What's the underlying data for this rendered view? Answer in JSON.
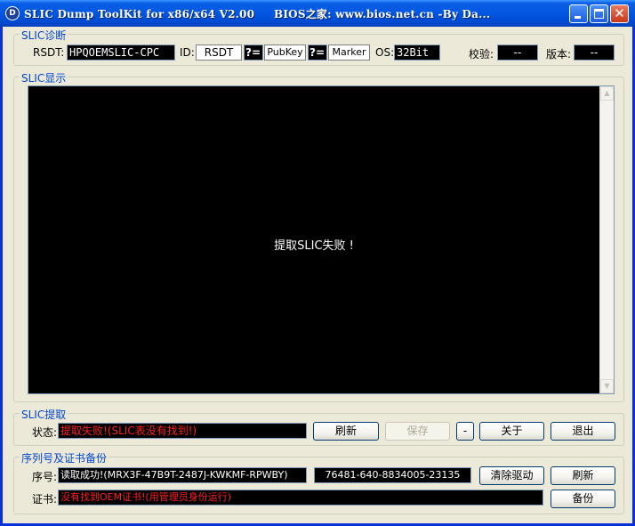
{
  "window": {
    "title": "SLIC Dump ToolKit for x86/x64 V2.00",
    "title_suffix": "BIOS之家: www.bios.net.cn  -By Da...",
    "icon_letter": "D"
  },
  "diag": {
    "legend": "SLIC诊断",
    "rsdt_label": "RSDT:",
    "rsdt_value": "HPQOEMSLIC-CPC",
    "id_label": "ID:",
    "id_value": "RSDT",
    "q1": "?=",
    "pubkey": "PubKey",
    "q2": "?=",
    "marker": "Marker",
    "os_label": "OS:",
    "os_value": "32Bit",
    "checksum_label": "校验:",
    "checksum_value": "--",
    "version_label": "版本:",
    "version_value": "--"
  },
  "display": {
    "legend": "SLIC显示",
    "message": "提取SLIC失败 !"
  },
  "extract": {
    "legend": "SLIC提取",
    "status_label": "状态:",
    "status_value": "提取失败!(SLIC表没有找到!)",
    "refresh": "刷新",
    "save": "保存",
    "dash": "-",
    "about": "关于",
    "exit": "退出"
  },
  "serial": {
    "legend": "序列号及证书备份",
    "serial_label": "序号:",
    "serial_value": "读取成功!(MRX3F-47B9T-2487J-KWKMF-RPWBY)",
    "product_id": "76481-640-8834005-23135",
    "clear_driver": "清除驱动",
    "refresh": "刷新",
    "cert_label": "证书:",
    "cert_value": "没有找到OEM证书!(用管理员身份运行)",
    "backup": "备份"
  },
  "colors": {
    "accent": "#0046d5",
    "error_text": "#ff2020"
  }
}
